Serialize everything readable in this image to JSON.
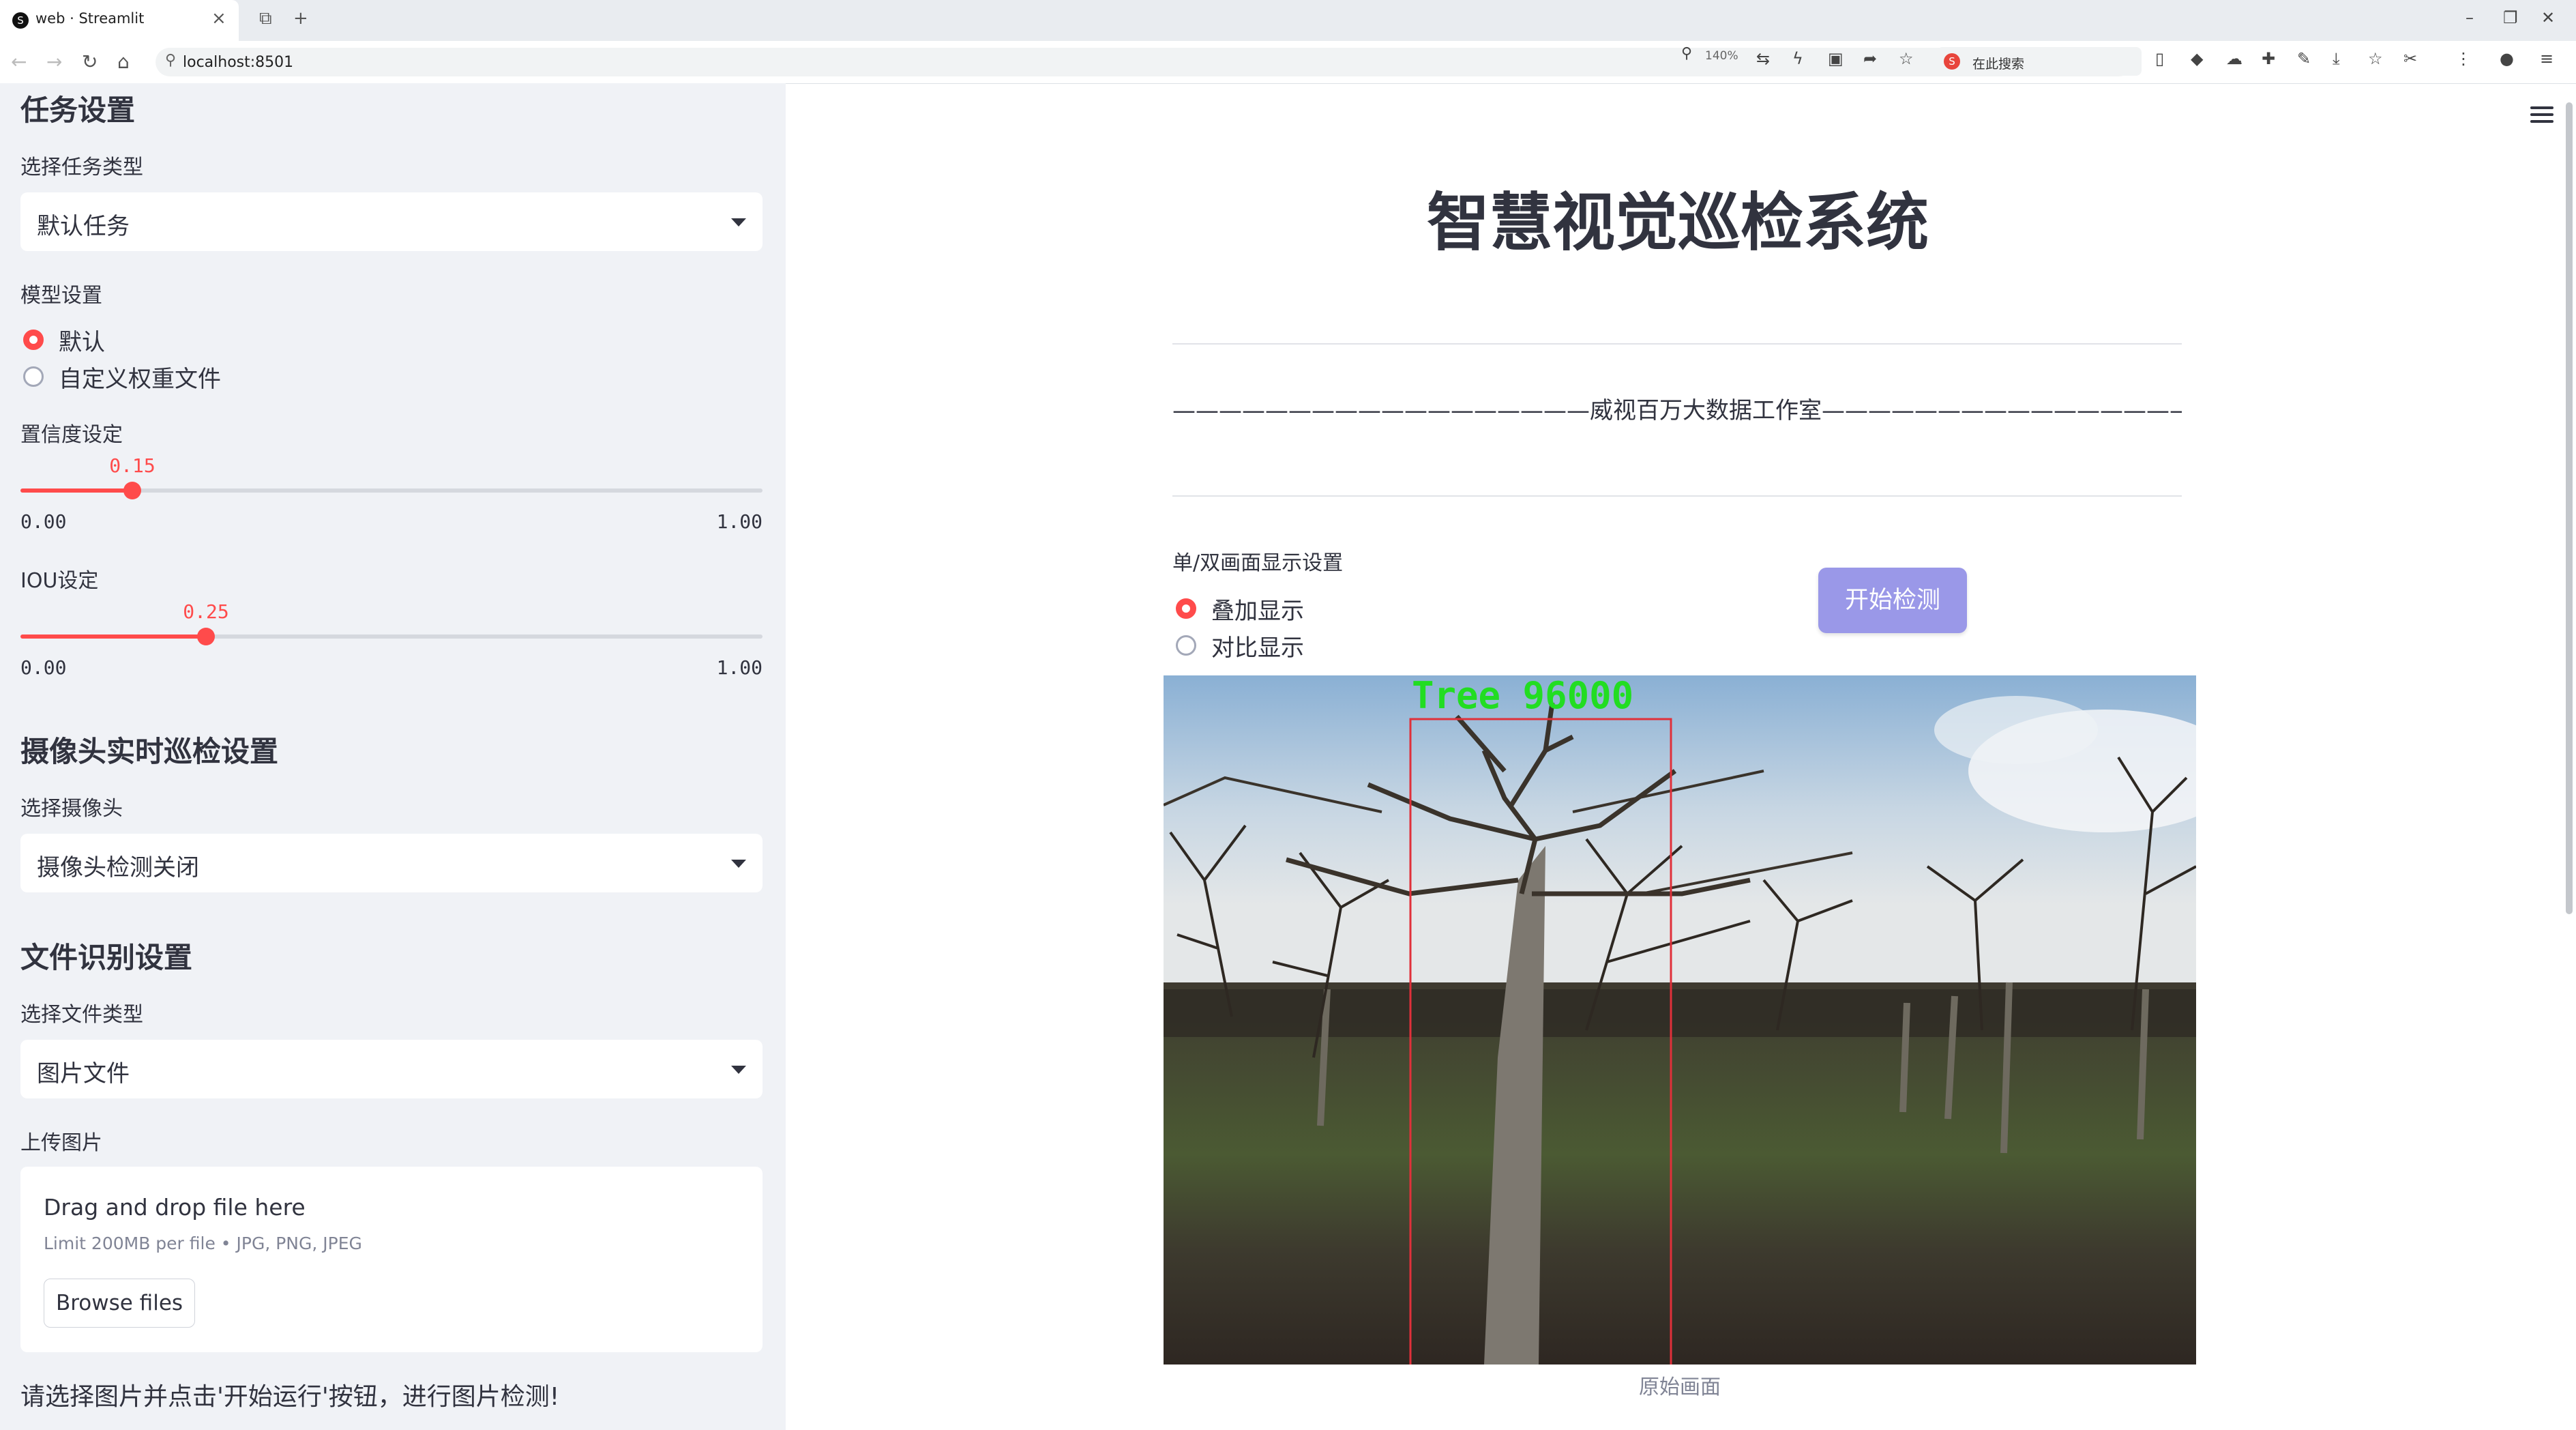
{
  "browser": {
    "tab_title": "web · Streamlit",
    "url": "localhost:8501",
    "zoom": "140%",
    "search_placeholder": "在此搜索"
  },
  "sidebar": {
    "task_heading": "任务设置",
    "task_type_label": "选择任务类型",
    "task_type_value": "默认任务",
    "model_label": "模型设置",
    "model_options": [
      "默认",
      "自定义权重文件"
    ],
    "model_selected": 0,
    "confidence_label": "置信度设定",
    "confidence_value": "0.15",
    "confidence_min": "0.00",
    "confidence_max": "1.00",
    "iou_label": "IOU设定",
    "iou_value": "0.25",
    "iou_min": "0.00",
    "iou_max": "1.00",
    "camera_heading": "摄像头实时巡检设置",
    "camera_label": "选择摄像头",
    "camera_value": "摄像头检测关闭",
    "file_heading": "文件识别设置",
    "file_type_label": "选择文件类型",
    "file_type_value": "图片文件",
    "upload_label": "上传图片",
    "upload_title": "Drag and drop file here",
    "upload_limit": "Limit 200MB per file • JPG, PNG, JPEG",
    "browse_label": "Browse files",
    "footer_text": "请选择图片并点击'开始运行'按钮，进行图片检测!"
  },
  "main": {
    "title": "智慧视觉巡检系统",
    "subtitle": "——————————————————威视百万大数据工作室———————————————————",
    "display_label": "单/双画面显示设置",
    "display_options": [
      "叠加显示",
      "对比显示"
    ],
    "display_selected": 0,
    "start_button": "开始检测",
    "detection_label": "Tree 96000",
    "image_caption": "原始画面"
  },
  "colors": {
    "accent": "#ff4b4b",
    "start_button": "#9a98e8",
    "sidebar_bg": "#f0f2f6",
    "detection_box": "#e0303a",
    "detection_text": "#22dd22"
  }
}
